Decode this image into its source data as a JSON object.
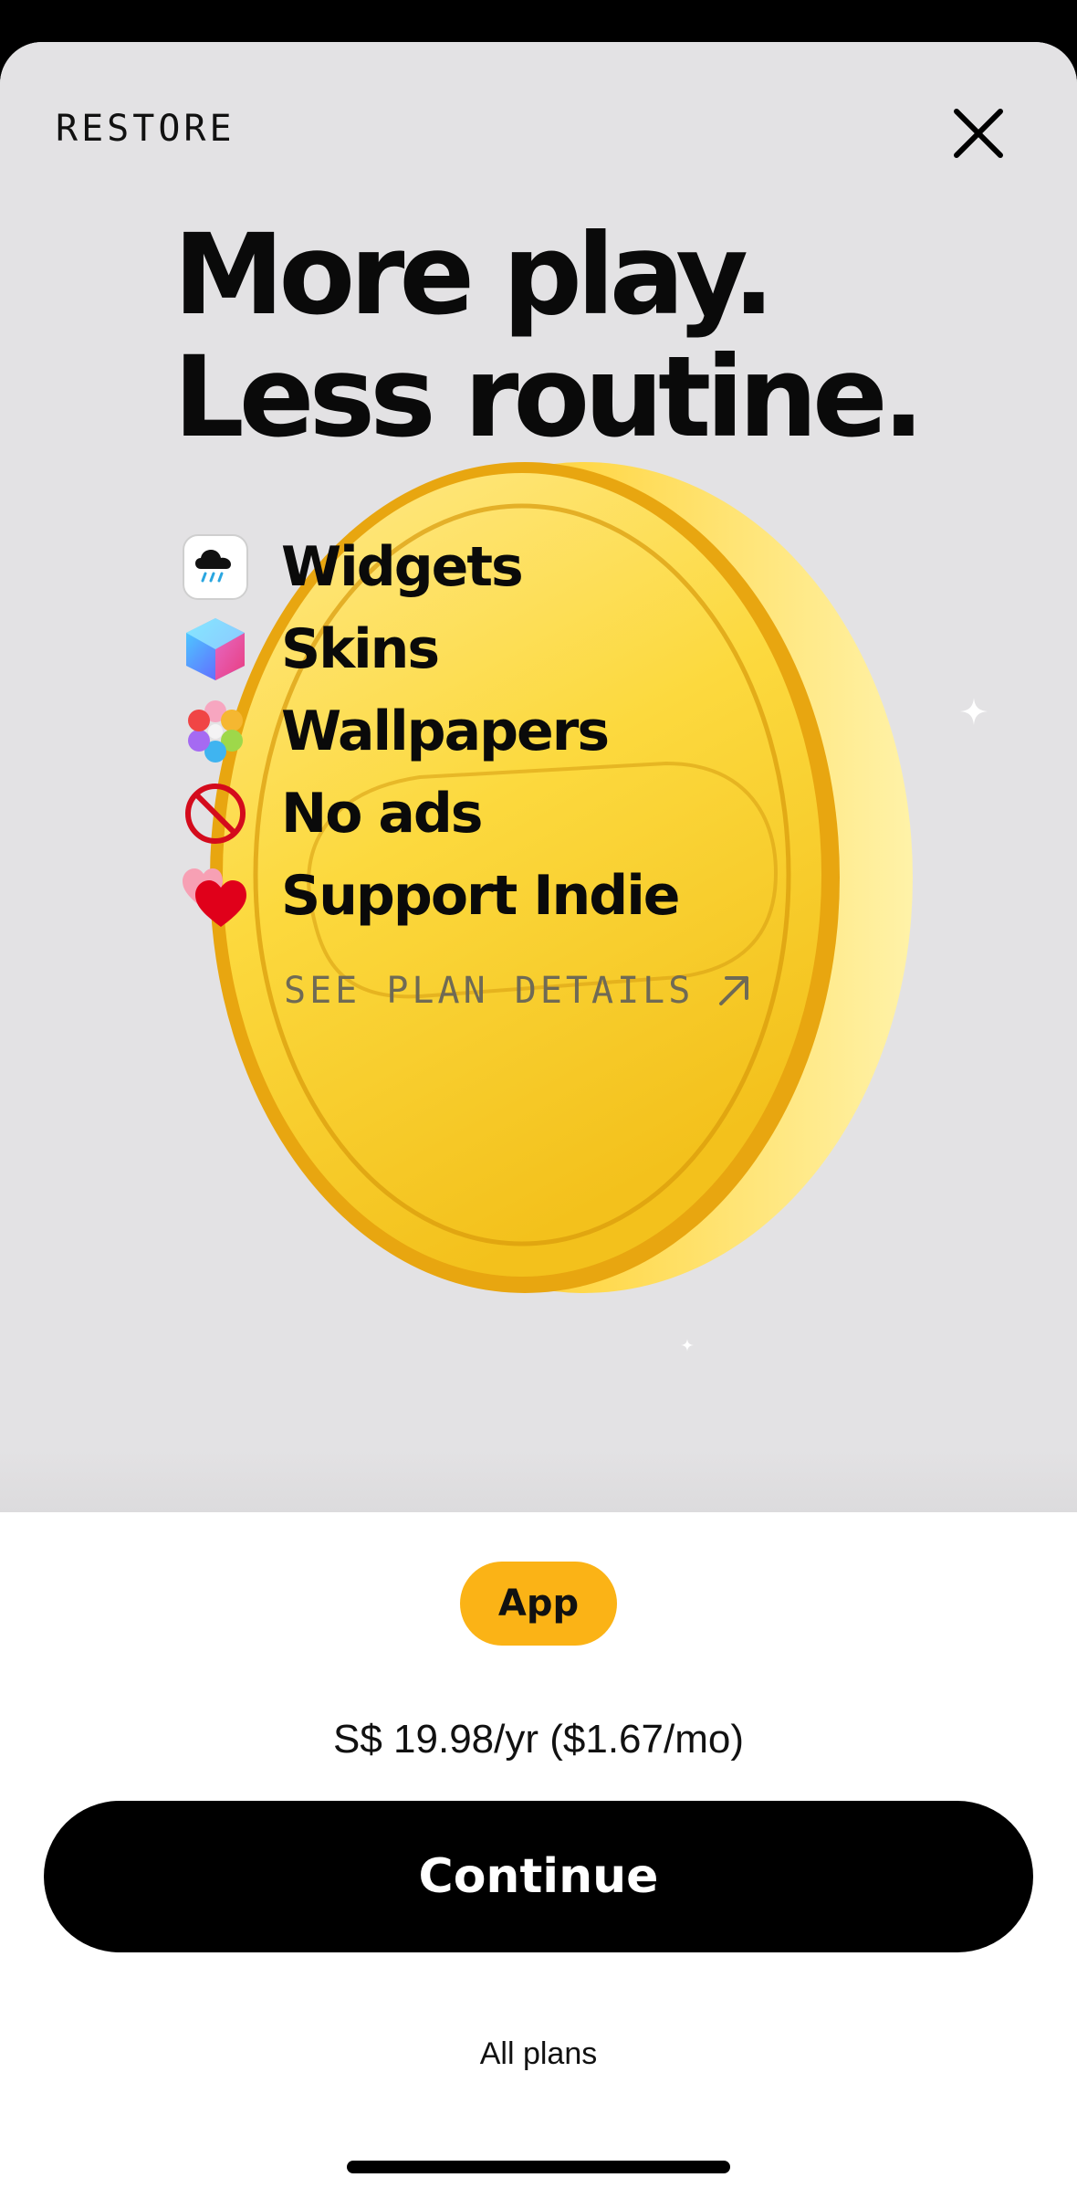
{
  "header": {
    "restore_label": "RESTORE"
  },
  "headline": {
    "line1": "More play.",
    "line2": "Less routine."
  },
  "features": [
    {
      "label": "Widgets",
      "icon": "rain-cloud-widget-icon"
    },
    {
      "label": "Skins",
      "icon": "color-cube-icon"
    },
    {
      "label": "Wallpapers",
      "icon": "flower-icon"
    },
    {
      "label": "No ads",
      "icon": "no-sign-icon"
    },
    {
      "label": "Support Indie",
      "icon": "hearts-icon"
    }
  ],
  "plan_details_label": "SEE PLAN DETAILS",
  "plan": {
    "badge": "App",
    "price": "S$ 19.98/yr ($1.67/mo)"
  },
  "continue_label": "Continue",
  "all_plans_label": "All plans",
  "colors": {
    "hero_background": "#e3e2e4",
    "badge": "#fbb316",
    "coin": "#f5c518",
    "button": "#000000"
  }
}
